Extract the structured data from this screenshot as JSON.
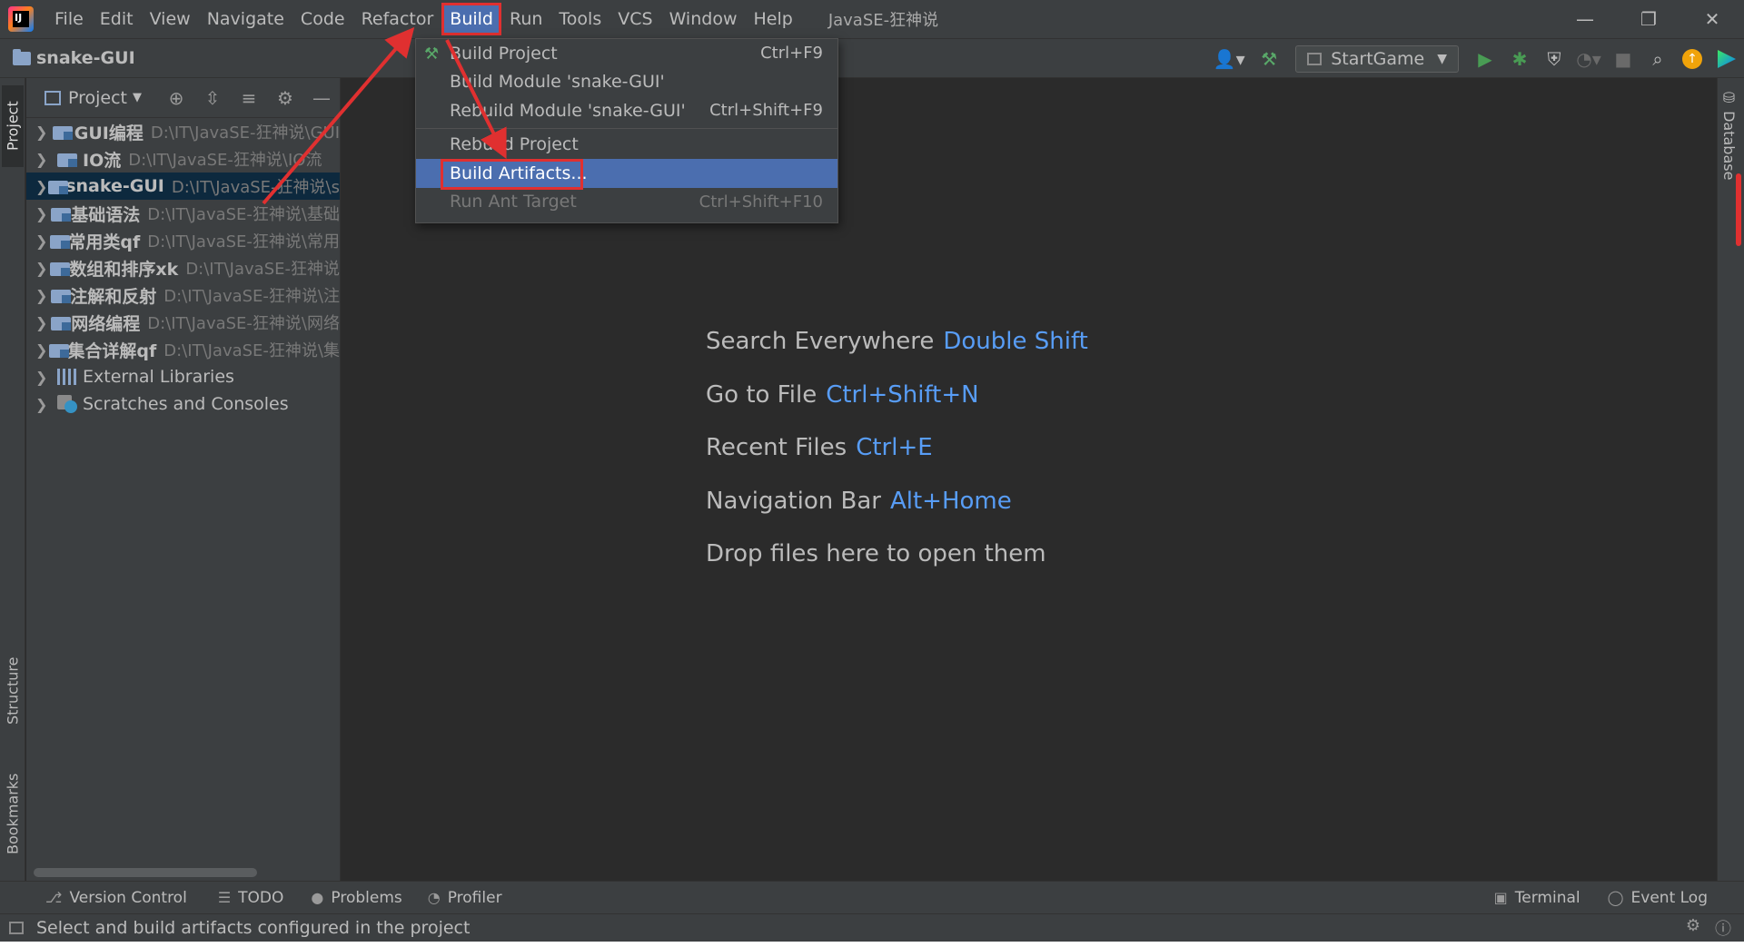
{
  "window": {
    "title": "JavaSE-狂神说",
    "min_icon": "minimize-icon",
    "restore_icon": "restore-icon",
    "close_icon": "close-icon"
  },
  "menubar": {
    "items": [
      "File",
      "Edit",
      "View",
      "Navigate",
      "Code",
      "Refactor",
      "Build",
      "Run",
      "Tools",
      "VCS",
      "Window",
      "Help"
    ],
    "active": "Build"
  },
  "navbar": {
    "project": "snake-GUI",
    "run_config": "StartGame"
  },
  "left_strip": {
    "tabs": [
      "Project",
      "Structure",
      "Bookmarks"
    ]
  },
  "right_strip": {
    "tabs": [
      "Database"
    ]
  },
  "project_panel": {
    "title": "Project",
    "tree": [
      {
        "name": "GUI编程",
        "path": "D:\\IT\\JavaSE-狂神说\\GUI"
      },
      {
        "name": "IO流",
        "path": "D:\\IT\\JavaSE-狂神说\\IO流"
      },
      {
        "name": "snake-GUI",
        "path": "D:\\IT\\JavaSE-狂神说\\s"
      },
      {
        "name": "基础语法",
        "path": "D:\\IT\\JavaSE-狂神说\\基础"
      },
      {
        "name": "常用类qf",
        "path": "D:\\IT\\JavaSE-狂神说\\常用"
      },
      {
        "name": "数组和排序xk",
        "path": "D:\\IT\\JavaSE-狂神说"
      },
      {
        "name": "注解和反射",
        "path": "D:\\IT\\JavaSE-狂神说\\注"
      },
      {
        "name": "网络编程",
        "path": "D:\\IT\\JavaSE-狂神说\\网络"
      },
      {
        "name": "集合详解qf",
        "path": "D:\\IT\\JavaSE-狂神说\\集"
      },
      {
        "name": "External Libraries",
        "path": ""
      },
      {
        "name": "Scratches and Consoles",
        "path": ""
      }
    ],
    "selected": "snake-GUI"
  },
  "build_menu": {
    "items": [
      {
        "label": "Build Project",
        "shortcut": "Ctrl+F9"
      },
      {
        "label": "Build Module 'snake-GUI'",
        "shortcut": ""
      },
      {
        "label": "Rebuild Module 'snake-GUI'",
        "shortcut": "Ctrl+Shift+F9"
      },
      {
        "label": "Rebuild Project",
        "shortcut": ""
      },
      {
        "label": "Build Artifacts...",
        "shortcut": ""
      },
      {
        "label": "Run Ant Target",
        "shortcut": "Ctrl+Shift+F10"
      }
    ],
    "highlighted": "Build Artifacts..."
  },
  "editor_hints": [
    {
      "text": "Search Everywhere",
      "key": "Double Shift"
    },
    {
      "text": "Go to File",
      "key": "Ctrl+Shift+N"
    },
    {
      "text": "Recent Files",
      "key": "Ctrl+E"
    },
    {
      "text": "Navigation Bar",
      "key": "Alt+Home"
    },
    {
      "text": "Drop files here to open them",
      "key": ""
    }
  ],
  "bottom_tools": {
    "left": [
      "Version Control",
      "TODO",
      "Problems",
      "Profiler"
    ],
    "right": [
      "Terminal",
      "Event Log"
    ]
  },
  "status": {
    "text": "Select and build artifacts configured in the project"
  },
  "colors": {
    "accent": "#4b6eaf",
    "annotation": "#e03030",
    "shortcut": "#589df6"
  }
}
